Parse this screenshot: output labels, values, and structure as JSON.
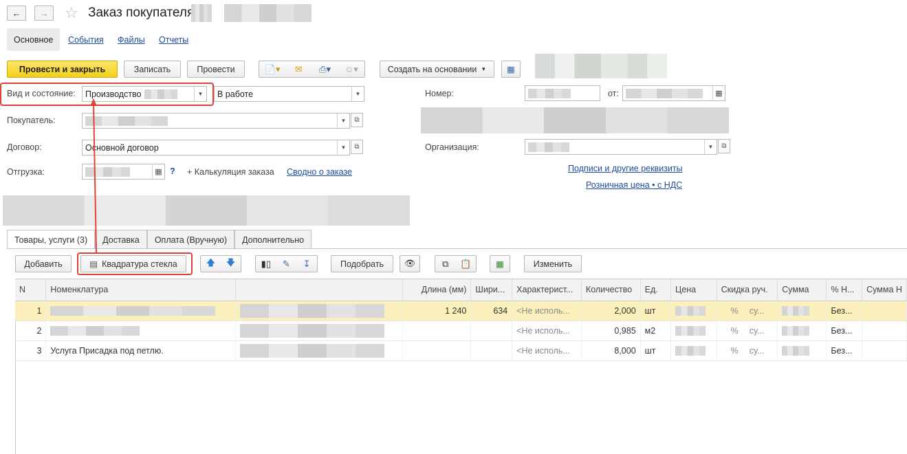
{
  "window": {
    "title": "Заказ покупателя"
  },
  "topnav": {
    "main": "Основное",
    "events": "События",
    "files": "Файлы",
    "reports": "Отчеты"
  },
  "toolbar": {
    "post_close": "Провести и закрыть",
    "save": "Записать",
    "post": "Провести",
    "create_based": "Создать на основании"
  },
  "form": {
    "kind_label": "Вид и состояние:",
    "kind_value": "Производство",
    "state_value": "В работе",
    "customer_label": "Покупатель:",
    "contract_label": "Договор:",
    "contract_value": "Основной договор",
    "shipment_label": "Отгрузка:",
    "help": "?",
    "calc": "+ Калькуляция заказа",
    "summary": "Сводно о заказе",
    "number_label": "Номер:",
    "date_label": "от:",
    "org_label": "Организация:",
    "signatures": "Подписи и другие реквизиты",
    "retail_price": "Розничная цена • с НДС"
  },
  "tabs": [
    "Товары, услуги (3)",
    "Доставка",
    "Оплата (Вручную)",
    "Дополнительно"
  ],
  "grid_toolbar": {
    "add": "Добавить",
    "glass": "Квадратура стекла",
    "pick": "Подобрать",
    "change": "Изменить"
  },
  "columns": [
    "N",
    "Номенклатура",
    "",
    "Длина (мм)",
    "Шири...",
    "Характерист...",
    "Количество",
    "Ед.",
    "Цена",
    "Скидка руч.",
    "Сумма",
    "% Н...",
    "Сумма Н"
  ],
  "rows": [
    {
      "n": "1",
      "name": "",
      "length": "1 240",
      "width": "634",
      "char": "<Не исполь...",
      "qty": "2,000",
      "unit": "шт",
      "pct": "%",
      "su": "су...",
      "vat": "Без..."
    },
    {
      "n": "2",
      "name": "",
      "length": "",
      "width": "",
      "char": "<Не исполь...",
      "qty": "0,985",
      "unit": "м2",
      "pct": "%",
      "su": "су...",
      "vat": "Без..."
    },
    {
      "n": "3",
      "name": "Услуга Присадка под петлю.",
      "length": "",
      "width": "",
      "char": "<Не исполь...",
      "qty": "8,000",
      "unit": "шт",
      "pct": "%",
      "su": "су...",
      "vat": "Без..."
    }
  ],
  "colors": {
    "primary_button": "#f4cf1a",
    "highlight": "#e0413a",
    "link": "#1c4b9a",
    "selected_row": "#fbefbc"
  }
}
